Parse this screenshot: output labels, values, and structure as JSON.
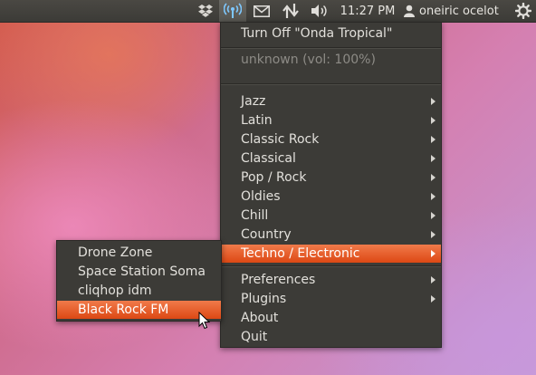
{
  "panel": {
    "indicators": [
      {
        "icon": "dropbox-icon"
      },
      {
        "icon": "radio-tray-antenna-icon",
        "active": true
      },
      {
        "icon": "mail-envelope-icon"
      },
      {
        "icon": "network-arrows-icon"
      },
      {
        "icon": "volume-speaker-icon"
      }
    ],
    "clock": "11:27 PM",
    "user": "oneiric ocelot",
    "session_icon": "power-gear-icon"
  },
  "radio_menu": {
    "turn_off": "Turn Off \"Onda Tropical\"",
    "status": "unknown (vol: 100%)",
    "genres": [
      "Jazz",
      "Latin",
      "Classic Rock",
      "Classical",
      "Pop / Rock",
      "Oldies",
      "Chill",
      "Country",
      "Techno / Electronic"
    ],
    "highlighted_genre": "Techno / Electronic",
    "preferences": "Preferences",
    "plugins": "Plugins",
    "about": "About",
    "quit": "Quit"
  },
  "station_submenu": {
    "stations": [
      "Drone Zone",
      "Space Station Soma",
      "cliqhop idm",
      "Black Rock FM"
    ],
    "highlighted_station": "Black Rock FM"
  },
  "colors": {
    "panel_bg": "#3c3b37",
    "menu_bg": "#3c3b37",
    "highlight": "#dd4814",
    "text": "#e2e0db",
    "dim_text": "#8d8b86"
  }
}
